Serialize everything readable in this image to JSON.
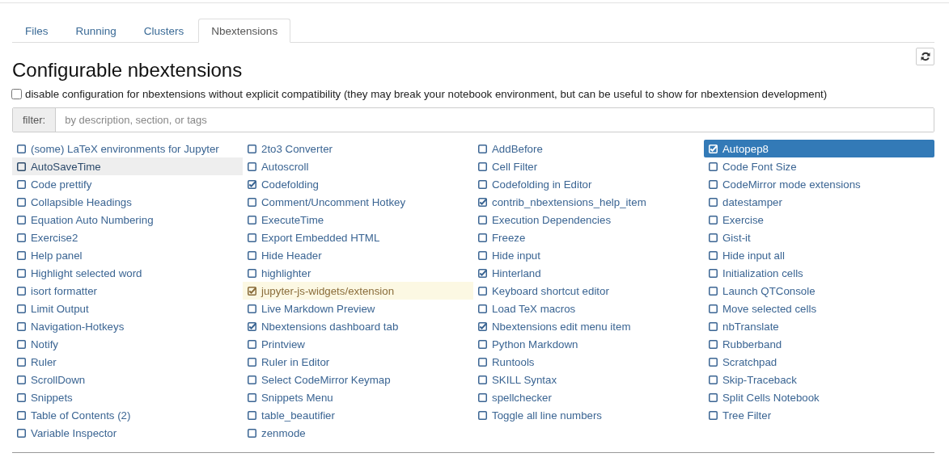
{
  "tabs": [
    {
      "label": "Files",
      "selected": false
    },
    {
      "label": "Running",
      "selected": false
    },
    {
      "label": "Clusters",
      "selected": false
    },
    {
      "label": "Nbextensions",
      "selected": true
    }
  ],
  "heading": "Configurable nbextensions",
  "compat_option": {
    "label": "disable configuration for nbextensions without explicit compatibility (they may break your notebook environment, but can be useful to show for nbextension development)",
    "checked": false
  },
  "filter": {
    "label": "filter:",
    "placeholder": "by description, section, or tags"
  },
  "extensions": [
    {
      "name": "(some) LaTeX environments for Jupyter",
      "checked": false,
      "selected": false,
      "kind": "plain"
    },
    {
      "name": "2to3 Converter",
      "checked": false,
      "selected": false,
      "kind": "plain"
    },
    {
      "name": "AddBefore",
      "checked": false,
      "selected": false,
      "kind": "plain"
    },
    {
      "name": "Autopep8",
      "checked": true,
      "selected": true,
      "kind": "plain"
    },
    {
      "name": "AutoSaveTime",
      "checked": false,
      "selected": false,
      "kind": "hovered"
    },
    {
      "name": "Autoscroll",
      "checked": false,
      "selected": false,
      "kind": "plain"
    },
    {
      "name": "Cell Filter",
      "checked": false,
      "selected": false,
      "kind": "plain"
    },
    {
      "name": "Code Font Size",
      "checked": false,
      "selected": false,
      "kind": "plain"
    },
    {
      "name": "Code prettify",
      "checked": false,
      "selected": false,
      "kind": "plain"
    },
    {
      "name": "Codefolding",
      "checked": true,
      "selected": false,
      "kind": "plain"
    },
    {
      "name": "Codefolding in Editor",
      "checked": false,
      "selected": false,
      "kind": "plain"
    },
    {
      "name": "CodeMirror mode extensions",
      "checked": false,
      "selected": false,
      "kind": "plain"
    },
    {
      "name": "Collapsible Headings",
      "checked": false,
      "selected": false,
      "kind": "plain"
    },
    {
      "name": "Comment/Uncomment Hotkey",
      "checked": false,
      "selected": false,
      "kind": "plain"
    },
    {
      "name": "contrib_nbextensions_help_item",
      "checked": true,
      "selected": false,
      "kind": "plain"
    },
    {
      "name": "datestamper",
      "checked": false,
      "selected": false,
      "kind": "plain"
    },
    {
      "name": "Equation Auto Numbering",
      "checked": false,
      "selected": false,
      "kind": "plain"
    },
    {
      "name": "ExecuteTime",
      "checked": false,
      "selected": false,
      "kind": "plain"
    },
    {
      "name": "Execution Dependencies",
      "checked": false,
      "selected": false,
      "kind": "plain"
    },
    {
      "name": "Exercise",
      "checked": false,
      "selected": false,
      "kind": "plain"
    },
    {
      "name": "Exercise2",
      "checked": false,
      "selected": false,
      "kind": "plain"
    },
    {
      "name": "Export Embedded HTML",
      "checked": false,
      "selected": false,
      "kind": "plain"
    },
    {
      "name": "Freeze",
      "checked": false,
      "selected": false,
      "kind": "plain"
    },
    {
      "name": "Gist-it",
      "checked": false,
      "selected": false,
      "kind": "plain"
    },
    {
      "name": "Help panel",
      "checked": false,
      "selected": false,
      "kind": "plain"
    },
    {
      "name": "Hide Header",
      "checked": false,
      "selected": false,
      "kind": "plain"
    },
    {
      "name": "Hide input",
      "checked": false,
      "selected": false,
      "kind": "plain"
    },
    {
      "name": "Hide input all",
      "checked": false,
      "selected": false,
      "kind": "plain"
    },
    {
      "name": "Highlight selected word",
      "checked": false,
      "selected": false,
      "kind": "plain"
    },
    {
      "name": "highlighter",
      "checked": false,
      "selected": false,
      "kind": "plain"
    },
    {
      "name": "Hinterland",
      "checked": true,
      "selected": false,
      "kind": "plain"
    },
    {
      "name": "Initialization cells",
      "checked": false,
      "selected": false,
      "kind": "plain"
    },
    {
      "name": "isort formatter",
      "checked": false,
      "selected": false,
      "kind": "plain"
    },
    {
      "name": "jupyter-js-widgets/extension",
      "checked": true,
      "selected": false,
      "kind": "incompatible"
    },
    {
      "name": "Keyboard shortcut editor",
      "checked": false,
      "selected": false,
      "kind": "plain"
    },
    {
      "name": "Launch QTConsole",
      "checked": false,
      "selected": false,
      "kind": "plain"
    },
    {
      "name": "Limit Output",
      "checked": false,
      "selected": false,
      "kind": "plain"
    },
    {
      "name": "Live Markdown Preview",
      "checked": false,
      "selected": false,
      "kind": "plain"
    },
    {
      "name": "Load TeX macros",
      "checked": false,
      "selected": false,
      "kind": "plain"
    },
    {
      "name": "Move selected cells",
      "checked": false,
      "selected": false,
      "kind": "plain"
    },
    {
      "name": "Navigation-Hotkeys",
      "checked": false,
      "selected": false,
      "kind": "plain"
    },
    {
      "name": "Nbextensions dashboard tab",
      "checked": true,
      "selected": false,
      "kind": "plain"
    },
    {
      "name": "Nbextensions edit menu item",
      "checked": true,
      "selected": false,
      "kind": "plain"
    },
    {
      "name": "nbTranslate",
      "checked": false,
      "selected": false,
      "kind": "plain"
    },
    {
      "name": "Notify",
      "checked": false,
      "selected": false,
      "kind": "plain"
    },
    {
      "name": "Printview",
      "checked": false,
      "selected": false,
      "kind": "plain"
    },
    {
      "name": "Python Markdown",
      "checked": false,
      "selected": false,
      "kind": "plain"
    },
    {
      "name": "Rubberband",
      "checked": false,
      "selected": false,
      "kind": "plain"
    },
    {
      "name": "Ruler",
      "checked": false,
      "selected": false,
      "kind": "plain"
    },
    {
      "name": "Ruler in Editor",
      "checked": false,
      "selected": false,
      "kind": "plain"
    },
    {
      "name": "Runtools",
      "checked": false,
      "selected": false,
      "kind": "plain"
    },
    {
      "name": "Scratchpad",
      "checked": false,
      "selected": false,
      "kind": "plain"
    },
    {
      "name": "ScrollDown",
      "checked": false,
      "selected": false,
      "kind": "plain"
    },
    {
      "name": "Select CodeMirror Keymap",
      "checked": false,
      "selected": false,
      "kind": "plain"
    },
    {
      "name": "SKILL Syntax",
      "checked": false,
      "selected": false,
      "kind": "plain"
    },
    {
      "name": "Skip-Traceback",
      "checked": false,
      "selected": false,
      "kind": "plain"
    },
    {
      "name": "Snippets",
      "checked": false,
      "selected": false,
      "kind": "plain"
    },
    {
      "name": "Snippets Menu",
      "checked": false,
      "selected": false,
      "kind": "plain"
    },
    {
      "name": "spellchecker",
      "checked": false,
      "selected": false,
      "kind": "plain"
    },
    {
      "name": "Split Cells Notebook",
      "checked": false,
      "selected": false,
      "kind": "plain"
    },
    {
      "name": "Table of Contents (2)",
      "checked": false,
      "selected": false,
      "kind": "plain"
    },
    {
      "name": "table_beautifier",
      "checked": false,
      "selected": false,
      "kind": "plain"
    },
    {
      "name": "Toggle all line numbers",
      "checked": false,
      "selected": false,
      "kind": "plain"
    },
    {
      "name": "Tree Filter",
      "checked": false,
      "selected": false,
      "kind": "plain"
    },
    {
      "name": "Variable Inspector",
      "checked": false,
      "selected": false,
      "kind": "plain"
    },
    {
      "name": "zenmode",
      "checked": false,
      "selected": false,
      "kind": "plain"
    }
  ]
}
